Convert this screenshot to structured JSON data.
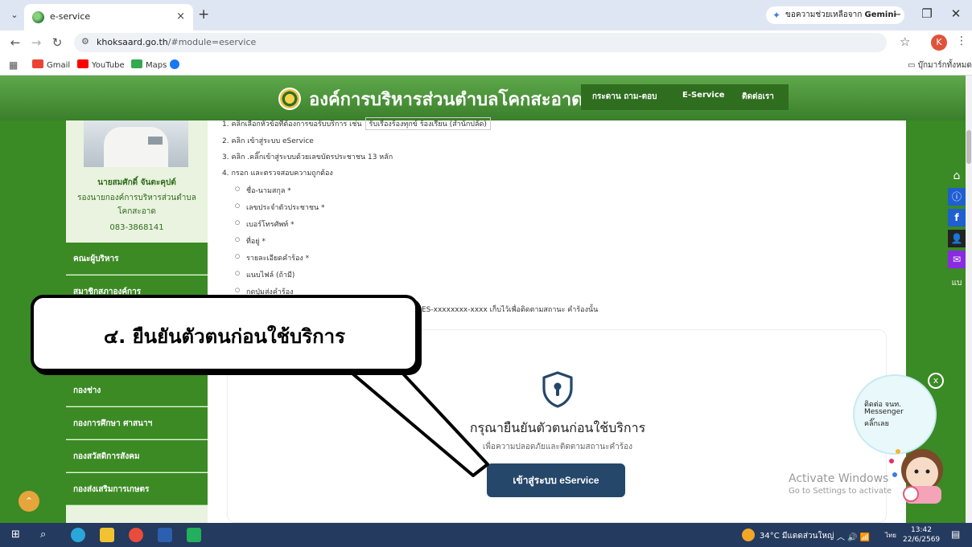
{
  "browser": {
    "tab_title": "e-service",
    "tab_close": "×",
    "new_tab": "+",
    "gemini_label": "ขอความช่วยเหลือจาก",
    "gemini_brand": "Gemini",
    "url_host": "khoksaard.go.th",
    "url_path": "/#module=eservice",
    "profile_initial": "K",
    "bookmarks": [
      {
        "label": "Gmail",
        "color": "#ea4335"
      },
      {
        "label": "YouTube",
        "color": "#ff0000"
      },
      {
        "label": "Maps",
        "color": "#34a853"
      }
    ],
    "all_bookmarks": "บุ๊กมาร์กทั้งหมด"
  },
  "site": {
    "name": "องค์การบริหารส่วนตำบลโคกสะอาด",
    "nav": [
      "กระดาน ถาม-ตอบ",
      "E-Service",
      "ติดต่อเรา"
    ],
    "accent": "#3b8a24",
    "header_color": "#4a9c2c"
  },
  "sidebar": {
    "person_name": "นายสมศักดิ์ จันตะคุปต์",
    "person_position": "รองนายกองค์การบริหารส่วนตำบล",
    "person_org": "โคกสะอาด",
    "person_phone": "083-3868141",
    "menu": [
      "คณะผู้บริหาร",
      "สมาชิกสภาองค์การ",
      "",
      "",
      "กองช่าง",
      "กองการศึกษา ศาสนาฯ",
      "กองสวัสดิการสังคม",
      "กองส่งเสริมการเกษตร"
    ]
  },
  "content": {
    "top_line": "1. คลิกเลือกหัวข้อที่ต้องการขอรับบริการ เช่น",
    "top_chip": "รับเรื่องร้องทุกข์ ร้องเรียน (สำนักปลัด)",
    "steps": [
      "2. คลิก เข้าสู่ระบบ eService",
      "3. คลิก .คลิ๊กเข้าสู่ระบบด้วยเลขบัตรประชาชน 13 หลัก",
      "4. กรอก และตรวจสอบความถูกต้อง"
    ],
    "fields": [
      "ชื่อ-นามสกุล *",
      "เลขประจำตัวประชาชน *",
      "เบอร์โทรศัพท์ *",
      "ที่อยู่ *",
      "รายละเอียดคำร้อง *",
      "แนบไฟล์ (ถ้ามี)",
      "กดปุ่มส่งคำร้อง"
    ],
    "tracking_note": "ES-xxxxxxxx-xxxx เก็บไว้เพื่อติดตามสถานะ คำร้องนั้น",
    "verify_title": "กรุณายืนยันตัวตนก่อนใช้บริการ",
    "verify_subtitle": "เพื่อความปลอดภัยและติดตามสถานะคำร้อง",
    "login_button": "เข้าสู่ระบบ eService"
  },
  "callout": {
    "text": "๔. ยืนยันตัวตนก่อนใช้บริการ"
  },
  "floating_bar": {
    "home": "⌂",
    "info": "ⓘ",
    "facebook": "f",
    "user": "👤",
    "mail": "✉",
    "more": "แบ"
  },
  "chat_widget": {
    "close": "x",
    "line1": "ติดต่อ จนท.",
    "line2": "Messenger",
    "line3": "คลิ๊กเลย"
  },
  "activation": {
    "title": "Activate Windows",
    "subtitle": "Go to Settings to activate"
  },
  "taskbar": {
    "weather": "34°C มีแดดส่วนใหญ่",
    "lang": "ไทย",
    "time": "13:42",
    "date": "22/6/2569"
  }
}
